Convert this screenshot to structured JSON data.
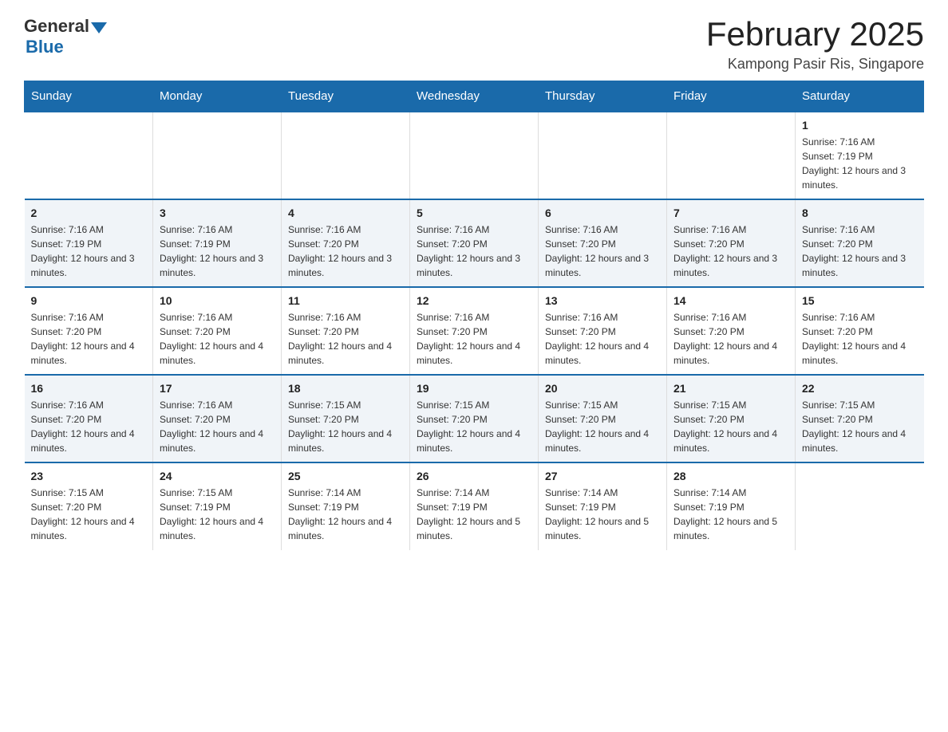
{
  "logo": {
    "general": "General",
    "blue": "Blue"
  },
  "header": {
    "title": "February 2025",
    "location": "Kampong Pasir Ris, Singapore"
  },
  "days_of_week": [
    "Sunday",
    "Monday",
    "Tuesday",
    "Wednesday",
    "Thursday",
    "Friday",
    "Saturday"
  ],
  "weeks": [
    {
      "days": [
        {
          "date": "",
          "sunrise": "",
          "sunset": "",
          "daylight": "",
          "empty": true
        },
        {
          "date": "",
          "sunrise": "",
          "sunset": "",
          "daylight": "",
          "empty": true
        },
        {
          "date": "",
          "sunrise": "",
          "sunset": "",
          "daylight": "",
          "empty": true
        },
        {
          "date": "",
          "sunrise": "",
          "sunset": "",
          "daylight": "",
          "empty": true
        },
        {
          "date": "",
          "sunrise": "",
          "sunset": "",
          "daylight": "",
          "empty": true
        },
        {
          "date": "",
          "sunrise": "",
          "sunset": "",
          "daylight": "",
          "empty": true
        },
        {
          "date": "1",
          "sunrise": "Sunrise: 7:16 AM",
          "sunset": "Sunset: 7:19 PM",
          "daylight": "Daylight: 12 hours and 3 minutes.",
          "empty": false
        }
      ]
    },
    {
      "days": [
        {
          "date": "2",
          "sunrise": "Sunrise: 7:16 AM",
          "sunset": "Sunset: 7:19 PM",
          "daylight": "Daylight: 12 hours and 3 minutes.",
          "empty": false
        },
        {
          "date": "3",
          "sunrise": "Sunrise: 7:16 AM",
          "sunset": "Sunset: 7:19 PM",
          "daylight": "Daylight: 12 hours and 3 minutes.",
          "empty": false
        },
        {
          "date": "4",
          "sunrise": "Sunrise: 7:16 AM",
          "sunset": "Sunset: 7:20 PM",
          "daylight": "Daylight: 12 hours and 3 minutes.",
          "empty": false
        },
        {
          "date": "5",
          "sunrise": "Sunrise: 7:16 AM",
          "sunset": "Sunset: 7:20 PM",
          "daylight": "Daylight: 12 hours and 3 minutes.",
          "empty": false
        },
        {
          "date": "6",
          "sunrise": "Sunrise: 7:16 AM",
          "sunset": "Sunset: 7:20 PM",
          "daylight": "Daylight: 12 hours and 3 minutes.",
          "empty": false
        },
        {
          "date": "7",
          "sunrise": "Sunrise: 7:16 AM",
          "sunset": "Sunset: 7:20 PM",
          "daylight": "Daylight: 12 hours and 3 minutes.",
          "empty": false
        },
        {
          "date": "8",
          "sunrise": "Sunrise: 7:16 AM",
          "sunset": "Sunset: 7:20 PM",
          "daylight": "Daylight: 12 hours and 3 minutes.",
          "empty": false
        }
      ]
    },
    {
      "days": [
        {
          "date": "9",
          "sunrise": "Sunrise: 7:16 AM",
          "sunset": "Sunset: 7:20 PM",
          "daylight": "Daylight: 12 hours and 4 minutes.",
          "empty": false
        },
        {
          "date": "10",
          "sunrise": "Sunrise: 7:16 AM",
          "sunset": "Sunset: 7:20 PM",
          "daylight": "Daylight: 12 hours and 4 minutes.",
          "empty": false
        },
        {
          "date": "11",
          "sunrise": "Sunrise: 7:16 AM",
          "sunset": "Sunset: 7:20 PM",
          "daylight": "Daylight: 12 hours and 4 minutes.",
          "empty": false
        },
        {
          "date": "12",
          "sunrise": "Sunrise: 7:16 AM",
          "sunset": "Sunset: 7:20 PM",
          "daylight": "Daylight: 12 hours and 4 minutes.",
          "empty": false
        },
        {
          "date": "13",
          "sunrise": "Sunrise: 7:16 AM",
          "sunset": "Sunset: 7:20 PM",
          "daylight": "Daylight: 12 hours and 4 minutes.",
          "empty": false
        },
        {
          "date": "14",
          "sunrise": "Sunrise: 7:16 AM",
          "sunset": "Sunset: 7:20 PM",
          "daylight": "Daylight: 12 hours and 4 minutes.",
          "empty": false
        },
        {
          "date": "15",
          "sunrise": "Sunrise: 7:16 AM",
          "sunset": "Sunset: 7:20 PM",
          "daylight": "Daylight: 12 hours and 4 minutes.",
          "empty": false
        }
      ]
    },
    {
      "days": [
        {
          "date": "16",
          "sunrise": "Sunrise: 7:16 AM",
          "sunset": "Sunset: 7:20 PM",
          "daylight": "Daylight: 12 hours and 4 minutes.",
          "empty": false
        },
        {
          "date": "17",
          "sunrise": "Sunrise: 7:16 AM",
          "sunset": "Sunset: 7:20 PM",
          "daylight": "Daylight: 12 hours and 4 minutes.",
          "empty": false
        },
        {
          "date": "18",
          "sunrise": "Sunrise: 7:15 AM",
          "sunset": "Sunset: 7:20 PM",
          "daylight": "Daylight: 12 hours and 4 minutes.",
          "empty": false
        },
        {
          "date": "19",
          "sunrise": "Sunrise: 7:15 AM",
          "sunset": "Sunset: 7:20 PM",
          "daylight": "Daylight: 12 hours and 4 minutes.",
          "empty": false
        },
        {
          "date": "20",
          "sunrise": "Sunrise: 7:15 AM",
          "sunset": "Sunset: 7:20 PM",
          "daylight": "Daylight: 12 hours and 4 minutes.",
          "empty": false
        },
        {
          "date": "21",
          "sunrise": "Sunrise: 7:15 AM",
          "sunset": "Sunset: 7:20 PM",
          "daylight": "Daylight: 12 hours and 4 minutes.",
          "empty": false
        },
        {
          "date": "22",
          "sunrise": "Sunrise: 7:15 AM",
          "sunset": "Sunset: 7:20 PM",
          "daylight": "Daylight: 12 hours and 4 minutes.",
          "empty": false
        }
      ]
    },
    {
      "days": [
        {
          "date": "23",
          "sunrise": "Sunrise: 7:15 AM",
          "sunset": "Sunset: 7:20 PM",
          "daylight": "Daylight: 12 hours and 4 minutes.",
          "empty": false
        },
        {
          "date": "24",
          "sunrise": "Sunrise: 7:15 AM",
          "sunset": "Sunset: 7:19 PM",
          "daylight": "Daylight: 12 hours and 4 minutes.",
          "empty": false
        },
        {
          "date": "25",
          "sunrise": "Sunrise: 7:14 AM",
          "sunset": "Sunset: 7:19 PM",
          "daylight": "Daylight: 12 hours and 4 minutes.",
          "empty": false
        },
        {
          "date": "26",
          "sunrise": "Sunrise: 7:14 AM",
          "sunset": "Sunset: 7:19 PM",
          "daylight": "Daylight: 12 hours and 5 minutes.",
          "empty": false
        },
        {
          "date": "27",
          "sunrise": "Sunrise: 7:14 AM",
          "sunset": "Sunset: 7:19 PM",
          "daylight": "Daylight: 12 hours and 5 minutes.",
          "empty": false
        },
        {
          "date": "28",
          "sunrise": "Sunrise: 7:14 AM",
          "sunset": "Sunset: 7:19 PM",
          "daylight": "Daylight: 12 hours and 5 minutes.",
          "empty": false
        },
        {
          "date": "",
          "sunrise": "",
          "sunset": "",
          "daylight": "",
          "empty": true
        }
      ]
    }
  ]
}
